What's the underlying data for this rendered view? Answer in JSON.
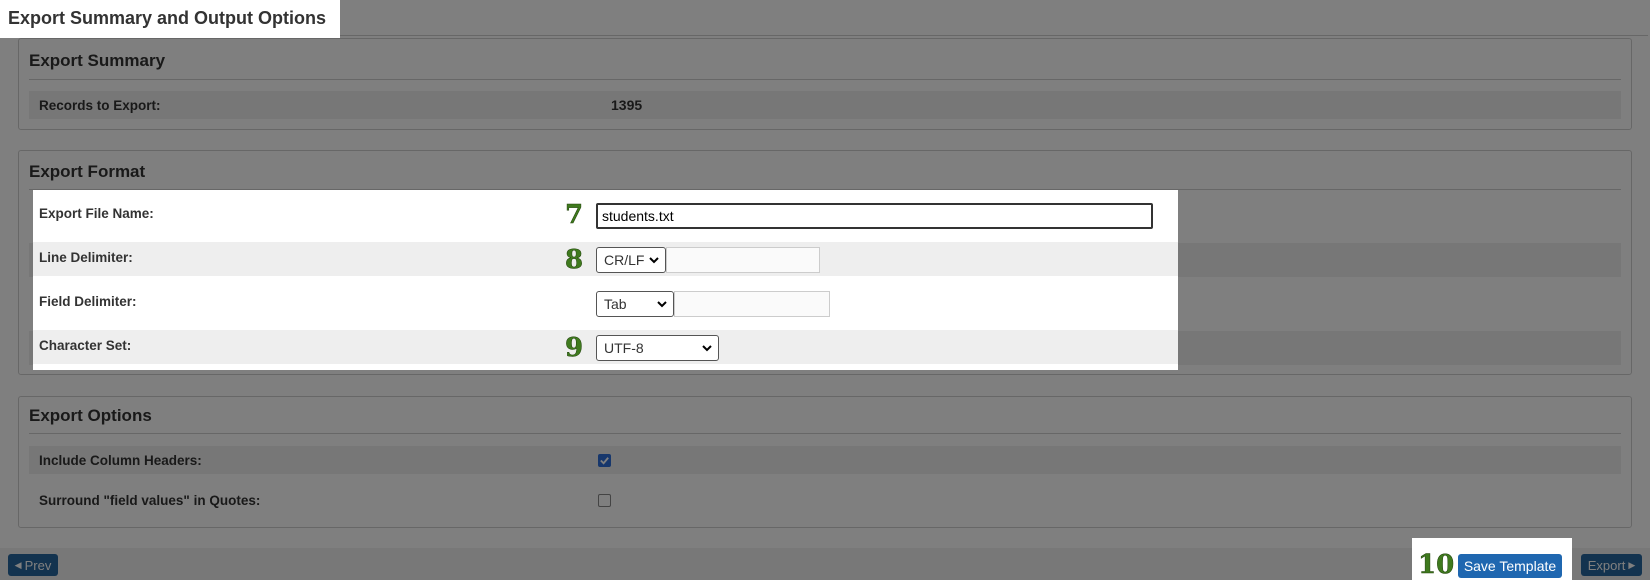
{
  "page_title": "Export Summary and Output Options",
  "summary": {
    "heading": "Export Summary",
    "records_label": "Records to Export:",
    "records_value": "1395"
  },
  "format": {
    "heading": "Export Format",
    "file_name_label": "Export File Name:",
    "file_name_value": "students.txt",
    "line_delim_label": "Line Delimiter:",
    "line_delim_value": "CR/LF",
    "field_delim_label": "Field Delimiter:",
    "field_delim_value": "Tab",
    "charset_label": "Character Set:",
    "charset_value": "UTF-8"
  },
  "options": {
    "heading": "Export Options",
    "headers_label": "Include Column Headers:",
    "headers_checked": true,
    "quotes_label": "Surround \"field values\" in Quotes:",
    "quotes_checked": false
  },
  "steps": {
    "file_name": "7",
    "line_delim": "8",
    "charset": "9",
    "save": "10"
  },
  "buttons": {
    "prev": "Prev",
    "save_template": "Save Template",
    "export": "Export"
  },
  "colors": {
    "accent": "#1f67b0",
    "step_number": "#3f7a1e"
  }
}
